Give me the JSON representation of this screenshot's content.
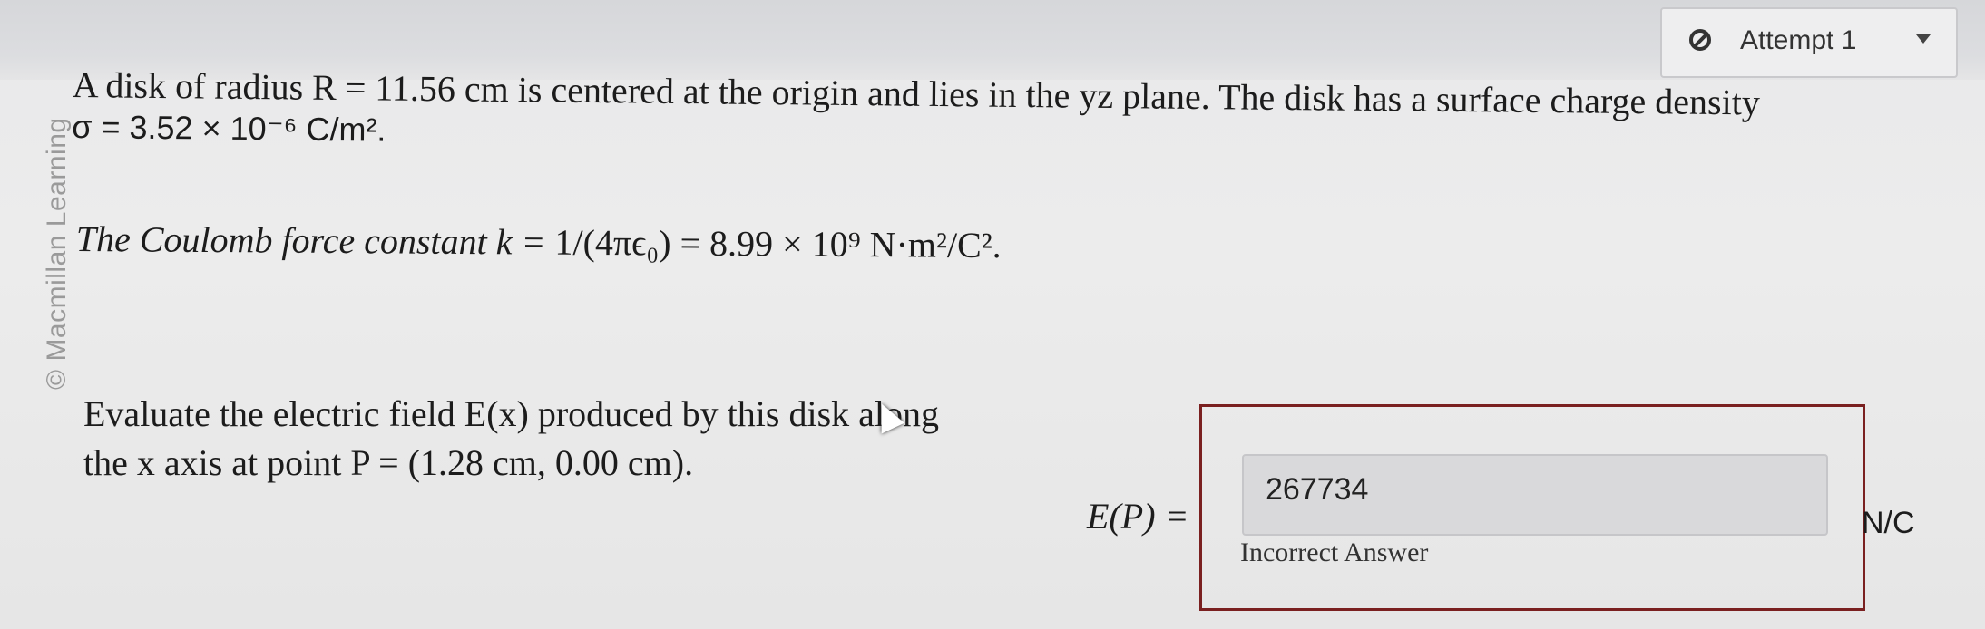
{
  "attempt": {
    "label": "Attempt 1",
    "icon": "ban-icon"
  },
  "watermark": "© Macmillan Learning",
  "problem": {
    "line1": "A disk of radius R = 11.56 cm is centered at the origin and lies in the yz plane. The disk has a surface charge density",
    "line2": "σ = 3.52 × 10⁻⁶ C/m².",
    "coulomb_prefix": "The Coulomb force constant k = ",
    "coulomb_eqn": "1/(4πϵ₀) = 8.99 × 10⁹ N·m²/C²."
  },
  "evaluate": {
    "line1": "Evaluate the electric field E(x) produced by this disk along",
    "line2": "the x axis at point P = (1.28 cm, 0.00 cm)."
  },
  "answer": {
    "label": "E(P) =",
    "value": "267734",
    "status": "Incorrect Answer",
    "units": "N/C"
  }
}
